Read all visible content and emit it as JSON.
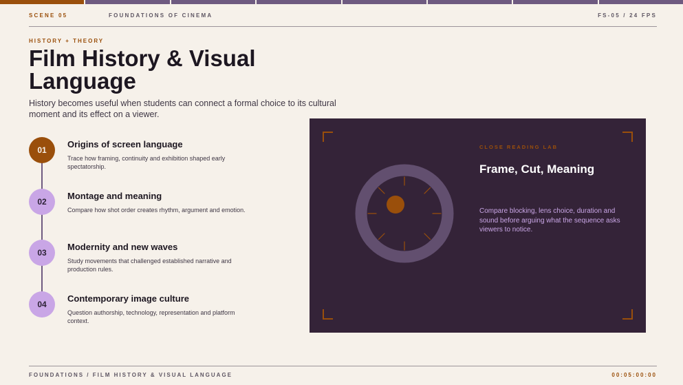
{
  "progress": {
    "segments": 8,
    "active_index": 0
  },
  "header": {
    "scene": "SCENE 05",
    "course": "FOUNDATIONS OF CINEMA",
    "fps": "FS-05 / 24 FPS"
  },
  "hero": {
    "eyebrow": "HISTORY + THEORY",
    "title": "Film History & Visual Language",
    "subtitle": "History becomes useful when students can connect a formal choice to its cultural moment and its effect on a viewer."
  },
  "steps": [
    {
      "number": "01",
      "title": "Origins of screen language",
      "desc": "Trace how framing, continuity and exhibition shaped early spectatorship."
    },
    {
      "number": "02",
      "title": "Montage and meaning",
      "desc": "Compare how shot order creates rhythm, argument and emotion."
    },
    {
      "number": "03",
      "title": "Modernity and new waves",
      "desc": "Study movements that challenged established narrative and production rules."
    },
    {
      "number": "04",
      "title": "Contemporary image culture",
      "desc": "Question authorship, technology, representation and platform context."
    }
  ],
  "panel": {
    "eyebrow": "CLOSE READING LAB",
    "title": "Frame, Cut, Meaning",
    "desc": "Compare blocking, lens choice, duration and sound before arguing what the sequence asks viewers to notice."
  },
  "footer": {
    "breadcrumb": "FOUNDATIONS / FILM HISTORY & VISUAL LANGUAGE",
    "timecode": "00:05:00:00"
  },
  "colors": {
    "accent": "#9a4f0b",
    "panel_bg": "#342338",
    "lavender": "#c9a6e6",
    "background": "#f6f1ea"
  }
}
